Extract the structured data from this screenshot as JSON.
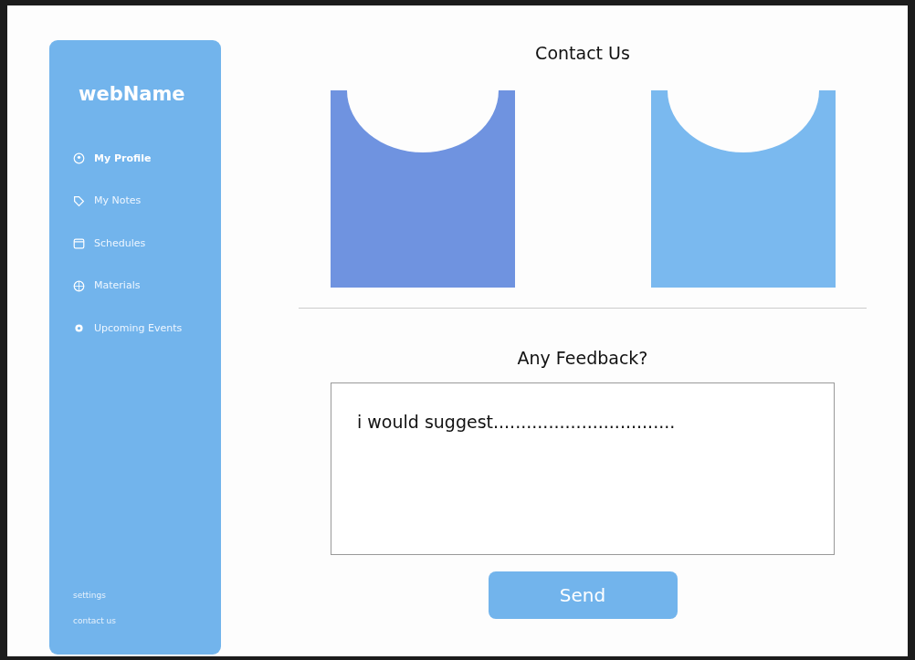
{
  "sidebar": {
    "brand": "webName",
    "items": [
      {
        "label": "My Profile",
        "selected": true
      },
      {
        "label": "My Notes",
        "selected": false
      },
      {
        "label": "Schedules",
        "selected": false
      },
      {
        "label": "Materials",
        "selected": false
      },
      {
        "label": "Upcoming Events",
        "selected": false
      }
    ],
    "footer_links": [
      "settings",
      "contact us"
    ]
  },
  "contact": {
    "title": "Contact Us",
    "cards": [
      {
        "color": "#6f93e0"
      },
      {
        "color": "#7ab9ef"
      }
    ]
  },
  "feedback": {
    "title": "Any Feedback?",
    "value": "i would suggest.................................",
    "button": "Send"
  }
}
